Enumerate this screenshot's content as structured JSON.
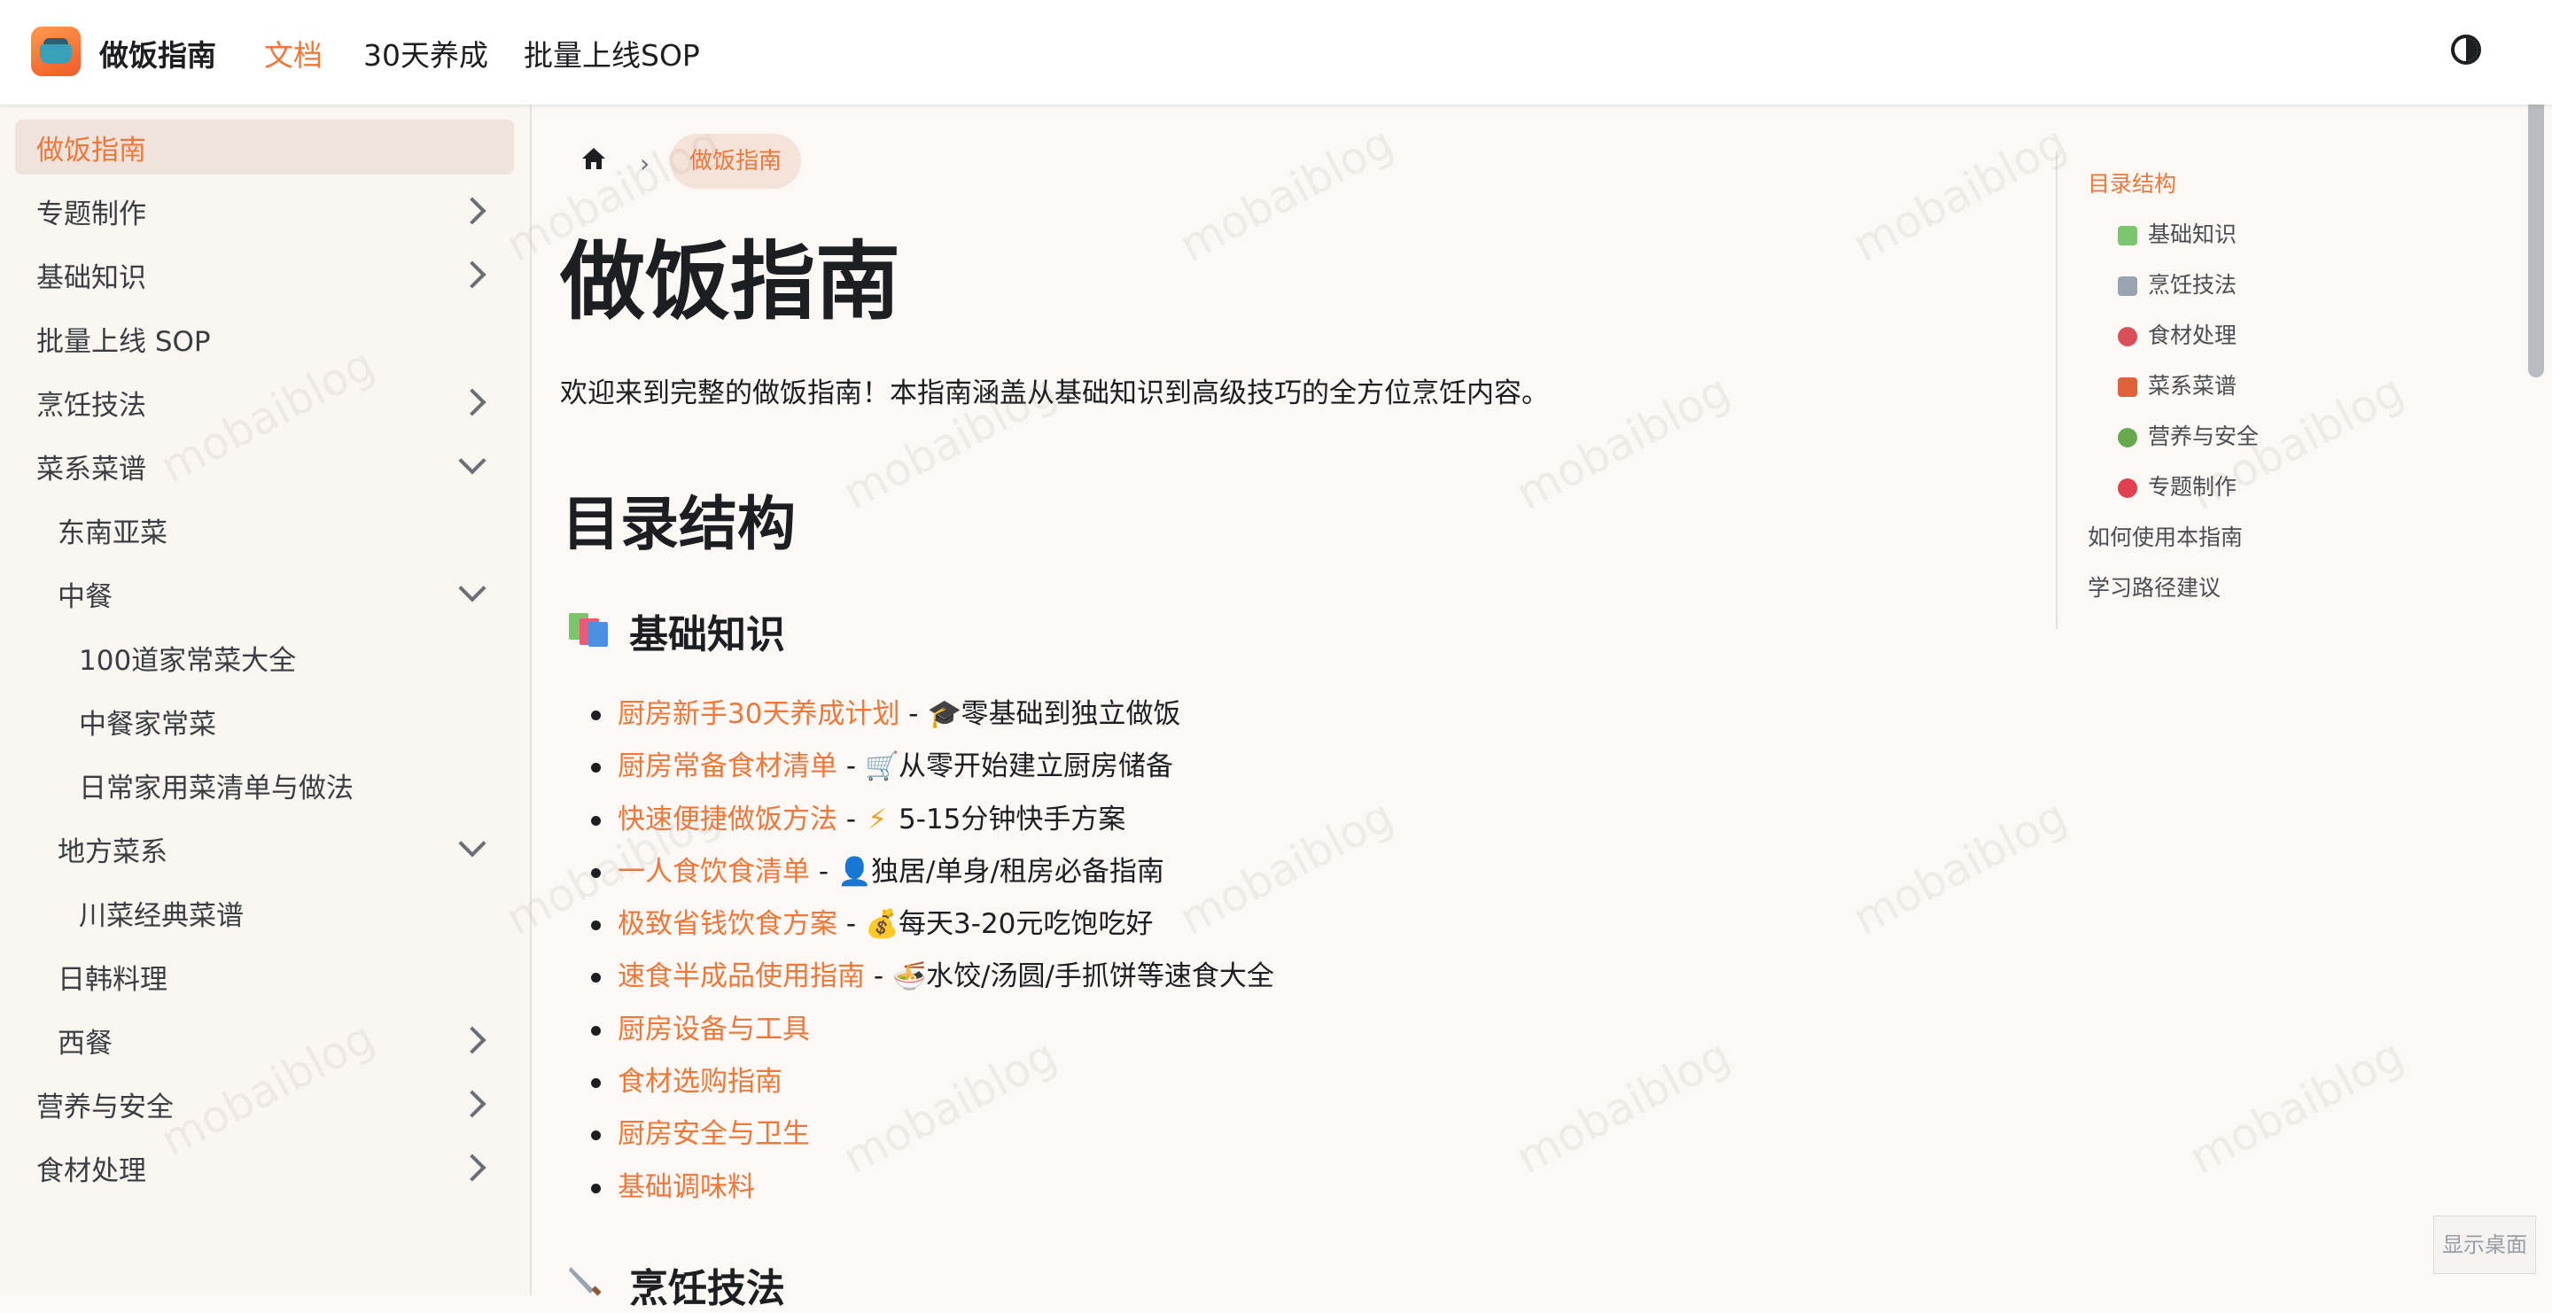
{
  "navbar": {
    "brand": "做饭指南",
    "links": [
      "文档",
      "30天养成",
      "批量上线SOP"
    ]
  },
  "sidebar": {
    "items": [
      {
        "label": "做饭指南",
        "expand": "none"
      },
      {
        "label": "专题制作",
        "expand": "collapsed"
      },
      {
        "label": "基础知识",
        "expand": "collapsed"
      },
      {
        "label": "批量上线 SOP",
        "expand": "none"
      },
      {
        "label": "烹饪技法",
        "expand": "collapsed"
      },
      {
        "label": "菜系菜谱",
        "expand": "expanded"
      },
      {
        "label": "东南亚菜",
        "expand": "none"
      },
      {
        "label": "中餐",
        "expand": "expanded"
      },
      {
        "label": "100道家常菜大全",
        "expand": "none"
      },
      {
        "label": "中餐家常菜",
        "expand": "none"
      },
      {
        "label": "日常家用菜清单与做法",
        "expand": "none"
      },
      {
        "label": "地方菜系",
        "expand": "expanded"
      },
      {
        "label": "川菜经典菜谱",
        "expand": "none"
      },
      {
        "label": "日韩料理",
        "expand": "none"
      },
      {
        "label": "西餐",
        "expand": "collapsed"
      },
      {
        "label": "营养与安全",
        "expand": "collapsed"
      },
      {
        "label": "食材处理",
        "expand": "collapsed"
      }
    ]
  },
  "breadcrumb": {
    "current": "做饭指南"
  },
  "main": {
    "title": "做饭指南",
    "intro": "欢迎来到完整的做饭指南！本指南涵盖从基础知识到高级技巧的全方位烹饪内容。",
    "section_title": "目录结构",
    "sub1": "基础知识",
    "sub2": "烹饪技法",
    "list": [
      {
        "link": "厨房新手30天养成计划",
        "icon": "graduation-cap-icon",
        "desc": "零基础到独立做饭"
      },
      {
        "link": "厨房常备食材清单",
        "icon": "shopping-cart-icon",
        "desc": "从零开始建立厨房储备"
      },
      {
        "link": "快速便捷做饭方法",
        "icon": "lightning-icon",
        "desc": "5-15分钟快手方案"
      },
      {
        "link": "一人食饮食清单",
        "icon": "person-icon",
        "desc": "独居/单身/租房必备指南"
      },
      {
        "link": "极致省钱饮食方案",
        "icon": "money-bag-icon",
        "desc": "每天3-20元吃饱吃好"
      },
      {
        "link": "速食半成品使用指南",
        "icon": "noodle-bowl-icon",
        "desc": "水饺/汤圆/手抓饼等速食大全"
      },
      {
        "link": "厨房设备与工具",
        "icon": "",
        "desc": ""
      },
      {
        "link": "食材选购指南",
        "icon": "",
        "desc": ""
      },
      {
        "link": "厨房安全与卫生",
        "icon": "",
        "desc": ""
      },
      {
        "link": "基础调味料",
        "icon": "",
        "desc": ""
      }
    ]
  },
  "toc": {
    "items": [
      "目录结构",
      "基础知识",
      "烹饪技法",
      "食材处理",
      "菜系菜谱",
      "营养与安全",
      "专题制作",
      "如何使用本指南",
      "学习路径建议"
    ]
  },
  "show_desktop": "显示桌面",
  "watermark": "mobaiblog",
  "colors": {
    "accent": "#f0773a",
    "text": "#1c1e21"
  }
}
